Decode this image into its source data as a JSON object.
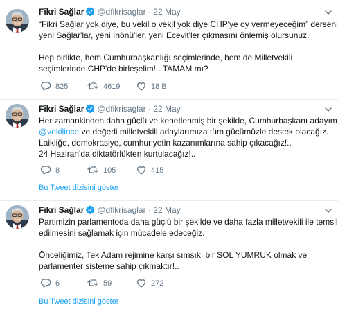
{
  "tweets": [
    {
      "author": "Fikri Sağlar",
      "handle": "@dfikrisaglar",
      "separator": "·",
      "date": "22 May",
      "lines": [
        "“Fikri Sağlar yok diye, bu vekil o vekil yok diye CHP'ye oy vermeyeceğim” derseniz,",
        "yeni Sağlar'lar, yeni İnönü'ler, yeni Ecevit'ler çıkmasını önlemiş olursunuz.",
        "",
        "Hep birlikte, hem Cumhurbaşkanlığı seçimlerinde, hem de Milletvekili",
        "seçimlerinde CHP'de birleşelim!.. TAMAM mı?"
      ],
      "replies": "825",
      "retweets": "4619",
      "likes": "18 B"
    },
    {
      "author": "Fikri Sağlar",
      "handle": "@dfikrisaglar",
      "separator": "·",
      "date": "22 May",
      "line1": "Her zamankinden daha güçlü ve kenetlenmiş bir şekilde, Cumhurbaşkanı adayımız",
      "line2_mention": "@vekilince",
      "line2_rest": " ve değerli milletvekili adaylarımıza tüm gücümüzle destek olacağız.",
      "line3": "Laikliğe, demokrasiye, cumhuriyetin kazanımlarına sahip çıkacağız!..",
      "line4": "24 Haziran'da diktatörlükten kurtulacağız!..",
      "replies": "8",
      "retweets": "105",
      "likes": "415",
      "thread_link": "Bu Tweet dizisini göster"
    },
    {
      "author": "Fikri Sağlar",
      "handle": "@dfikrisaglar",
      "separator": "·",
      "date": "22 May",
      "lines": [
        "Partimizin parlamentoda daha güçlü bir şekilde ve daha fazla milletvekili ile temsil",
        "edilmesini sağlamak için mücadele edeceğiz.",
        "",
        "Önceliğimiz, Tek Adam rejimine karşı sımsıkı bir SOL YUMRUK olmak ve",
        "parlamenter sisteme sahip çıkmaktır!.."
      ],
      "replies": "6",
      "retweets": "59",
      "likes": "272",
      "thread_link": "Bu Tweet dizisini göster"
    }
  ],
  "colors": {
    "link": "#1da1f2",
    "secondary_text": "#657786",
    "divider": "#e6ecf0"
  },
  "icons": [
    "verified-badge-icon",
    "chevron-down-icon",
    "reply-icon",
    "retweet-icon",
    "like-icon"
  ]
}
